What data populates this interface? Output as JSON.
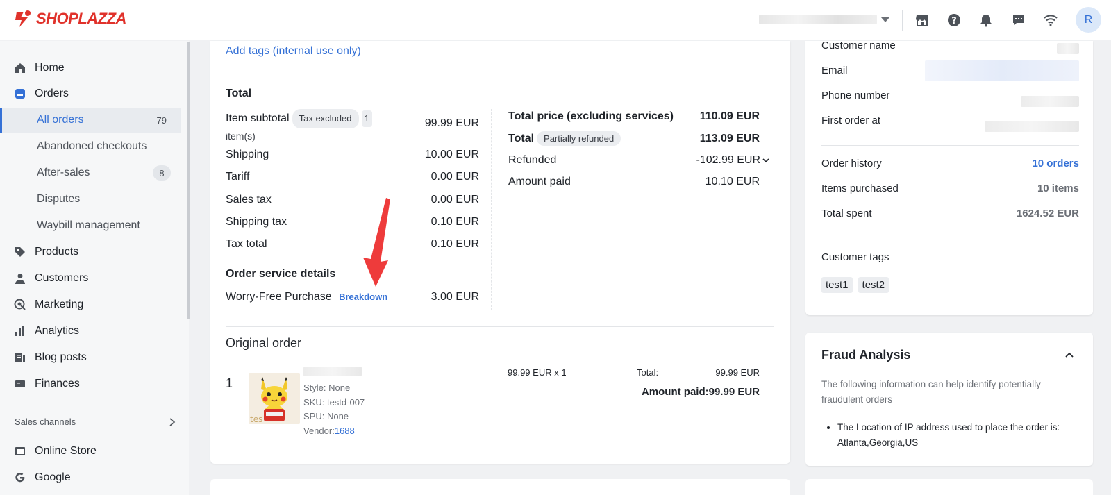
{
  "brand": {
    "name": "SHOPLAZZA",
    "color": "#e0322b"
  },
  "header": {
    "avatar_initial": "R",
    "icons": [
      "store-icon",
      "help-icon",
      "bell-icon",
      "chat-icon",
      "wifi-icon"
    ]
  },
  "sidebar": {
    "items": [
      {
        "label": "Home",
        "icon": "home-icon"
      },
      {
        "label": "Orders",
        "icon": "orders-icon"
      },
      {
        "label": "Products",
        "icon": "tag-icon"
      },
      {
        "label": "Customers",
        "icon": "person-icon"
      },
      {
        "label": "Marketing",
        "icon": "marketing-icon"
      },
      {
        "label": "Analytics",
        "icon": "chart-icon"
      },
      {
        "label": "Blog posts",
        "icon": "blog-icon"
      },
      {
        "label": "Finances",
        "icon": "finance-icon"
      }
    ],
    "order_subitems": [
      {
        "label": "All orders",
        "count": "79",
        "active": true
      },
      {
        "label": "Abandoned checkouts",
        "count": ""
      },
      {
        "label": "After-sales",
        "count": "8"
      },
      {
        "label": "Disputes",
        "count": ""
      },
      {
        "label": "Waybill management",
        "count": ""
      }
    ],
    "sales_channels_label": "Sales channels",
    "channels": [
      {
        "label": "Online Store",
        "icon": "store-icon"
      },
      {
        "label": "Google",
        "icon": "google-icon"
      }
    ]
  },
  "order": {
    "add_tags_link": "Add tags (internal use only)",
    "total_title": "Total",
    "item_subtotal_label": "Item subtotal",
    "tax_excluded_pill": "Tax excluded",
    "item_count_pill": "1",
    "item_count_suffix": "item(s)",
    "item_subtotal_value": "99.99 EUR",
    "shipping_label": "Shipping",
    "shipping_value": "10.00 EUR",
    "tariff_label": "Tariff",
    "tariff_value": "0.00 EUR",
    "sales_tax_label": "Sales tax",
    "sales_tax_value": "0.00 EUR",
    "shipping_tax_label": "Shipping tax",
    "shipping_tax_value": "0.10 EUR",
    "tax_total_label": "Tax total",
    "tax_total_value": "0.10 EUR",
    "service_title": "Order service details",
    "worry_free_label": "Worry-Free Purchase",
    "breakdown_link": "Breakdown",
    "worry_free_value": "3.00 EUR",
    "total_price_label": "Total price (excluding services)",
    "total_price_value": "110.09 EUR",
    "total_label": "Total",
    "partially_refunded_pill": "Partially refunded",
    "total_value": "113.09 EUR",
    "refunded_label": "Refunded",
    "refunded_value": "-102.99 EUR",
    "amount_paid_label": "Amount paid",
    "amount_paid_value": "10.10 EUR",
    "original_order_title": "Original order",
    "line_item": {
      "index": "1",
      "style": "Style: None",
      "sku": "SKU: testd-007",
      "spu": "SPU: None",
      "vendor_label": "Vendor:",
      "vendor_link": "1688",
      "unit_price_qty": "99.99 EUR x 1",
      "total_label": "Total:",
      "total_value": "99.99 EUR",
      "amount_paid": "Amount paid:99.99 EUR"
    }
  },
  "customer": {
    "name_label": "Customer name",
    "email_label": "Email",
    "phone_label": "Phone number",
    "first_order_label": "First order at",
    "order_history_label": "Order history",
    "order_history_value": "10 orders",
    "items_purchased_label": "Items purchased",
    "items_purchased_value": "10 items",
    "total_spent_label": "Total spent",
    "total_spent_value": "1624.52 EUR",
    "tags_label": "Customer tags",
    "tags": [
      "test1",
      "test2"
    ]
  },
  "fraud": {
    "title": "Fraud Analysis",
    "description": "The following information can help identify potentially fraudulent orders",
    "bullet": "The Location of IP address used to place the order is: Atlanta,Georgia,US"
  },
  "colors": {
    "accent": "#3571d6",
    "arrow": "#ee3b3b"
  }
}
